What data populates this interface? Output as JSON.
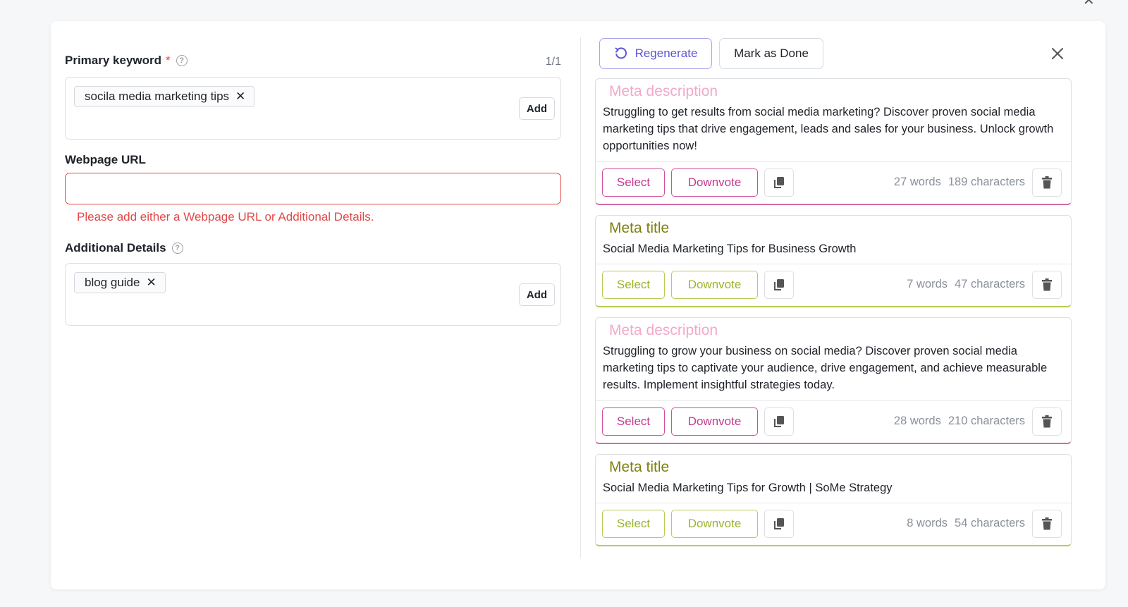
{
  "form": {
    "primary_keyword": {
      "label": "Primary keyword",
      "required_mark": "*",
      "counter": "1/1",
      "chips": [
        "socila media marketing tips"
      ],
      "add_label": "Add"
    },
    "webpage_url": {
      "label": "Webpage URL",
      "value": "",
      "error": "Please add either a Webpage URL or Additional Details."
    },
    "additional_details": {
      "label": "Additional Details",
      "chips": [
        "blog guide"
      ],
      "add_label": "Add"
    }
  },
  "toolbar": {
    "regenerate_label": "Regenerate",
    "mark_done_label": "Mark as Done"
  },
  "results": [
    {
      "type": "Meta description",
      "text": "Struggling to get results from social media marketing? Discover proven social media marketing tips that drive engagement, leads and sales for your business. Unlock growth opportunities now!",
      "select_label": "Select",
      "downvote_label": "Downvote",
      "words": "27 words",
      "characters": "189 characters"
    },
    {
      "type": "Meta title",
      "text": "Social Media Marketing Tips for Business Growth",
      "select_label": "Select",
      "downvote_label": "Downvote",
      "words": "7 words",
      "characters": "47 characters"
    },
    {
      "type": "Meta description",
      "text": "Struggling to grow your business on social media? Discover proven social media marketing tips to captivate your audience, drive engagement, and achieve measurable results. Implement insightful strategies today.",
      "select_label": "Select",
      "downvote_label": "Downvote",
      "words": "28 words",
      "characters": "210 characters"
    },
    {
      "type": "Meta title",
      "text": "Social Media Marketing Tips for Growth | SoMe Strategy",
      "select_label": "Select",
      "downvote_label": "Downvote",
      "words": "8 words",
      "characters": "54 characters"
    }
  ],
  "icons": {
    "help": "question-circle-icon",
    "remove_chip": "close-icon",
    "regenerate": "rotate-icon",
    "close_panel": "close-icon",
    "copy": "copy-icon",
    "delete": "trash-icon"
  },
  "colors": {
    "accent_purple": "#5e55d6",
    "error_red": "#e04848",
    "description_pink": "#d04f9e",
    "title_olive": "#b5cc55"
  }
}
